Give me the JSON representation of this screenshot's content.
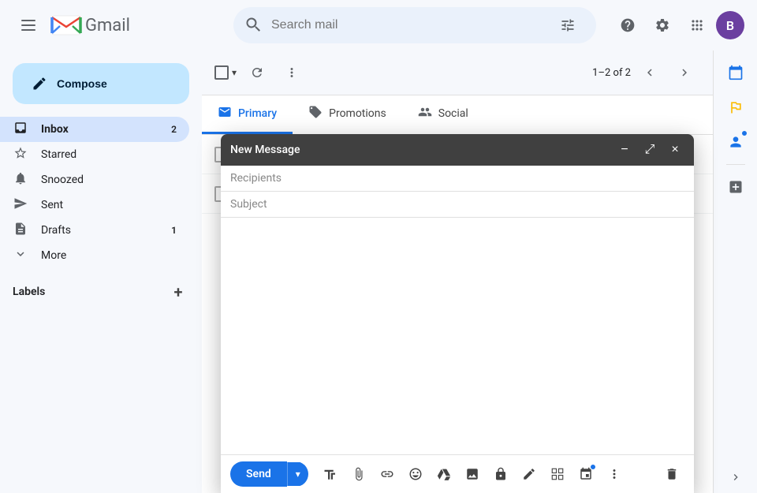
{
  "topbar": {
    "hamburger_label": "☰",
    "gmail_m": "M",
    "gmail_text": "Gmail",
    "search_placeholder": "Search mail",
    "filter_icon": "⚙",
    "help_icon": "?",
    "settings_icon": "⚙",
    "apps_icon": "⠿",
    "avatar_letter": "B",
    "avatar_color": "#6b3fa0"
  },
  "sidebar": {
    "compose_label": "Compose",
    "nav_items": [
      {
        "id": "inbox",
        "icon": "📥",
        "label": "Inbox",
        "badge": "2",
        "active": true
      },
      {
        "id": "starred",
        "icon": "☆",
        "label": "Starred",
        "badge": "",
        "active": false
      },
      {
        "id": "snoozed",
        "icon": "🕐",
        "label": "Snoozed",
        "badge": "",
        "active": false
      },
      {
        "id": "sent",
        "icon": "➤",
        "label": "Sent",
        "badge": "",
        "active": false
      },
      {
        "id": "drafts",
        "icon": "📄",
        "label": "Drafts",
        "badge": "1",
        "active": false
      },
      {
        "id": "more",
        "icon": "⌄",
        "label": "More",
        "badge": "",
        "active": false
      }
    ],
    "labels_title": "Labels",
    "labels_add_icon": "+"
  },
  "toolbar": {
    "page_info": "1–2 of 2",
    "prev_icon": "‹",
    "next_icon": "›",
    "refresh_icon": "↻",
    "more_icon": "⋮"
  },
  "tabs": [
    {
      "id": "primary",
      "icon": "🖥",
      "label": "Primary",
      "active": true
    },
    {
      "id": "promotions",
      "icon": "🏷",
      "label": "Promotions",
      "active": false
    },
    {
      "id": "social",
      "icon": "👤",
      "label": "Social",
      "active": false
    }
  ],
  "compose_window": {
    "title": "New Message",
    "minimize_icon": "−",
    "maximize_icon": "⤢",
    "close_icon": "×",
    "recipients_placeholder": "Recipients",
    "subject_placeholder": "Subject",
    "body_placeholder": "",
    "send_label": "Send",
    "footer_icons": [
      {
        "id": "format",
        "icon": "A",
        "title": "Formatting options"
      },
      {
        "id": "attach",
        "icon": "📎",
        "title": "Attach files"
      },
      {
        "id": "link",
        "icon": "🔗",
        "title": "Insert link"
      },
      {
        "id": "emoji",
        "icon": "😊",
        "title": "Insert emoji"
      },
      {
        "id": "drive",
        "icon": "△",
        "title": "Insert files using Drive"
      },
      {
        "id": "photo",
        "icon": "🖼",
        "title": "Insert photo"
      },
      {
        "id": "lock",
        "icon": "🔒",
        "title": "Toggle confidential mode"
      },
      {
        "id": "signature",
        "icon": "✍",
        "title": "Insert signature"
      },
      {
        "id": "more_options",
        "icon": "⬜",
        "title": "More options"
      },
      {
        "id": "schedule",
        "icon": "📅",
        "title": "Schedule send"
      }
    ],
    "more_footer_icon": "⋮",
    "delete_icon": "🗑"
  },
  "right_sidebar": {
    "calendar_icon": "📅",
    "tasks_icon": "✓",
    "contacts_icon": "👤",
    "add_icon": "+"
  }
}
